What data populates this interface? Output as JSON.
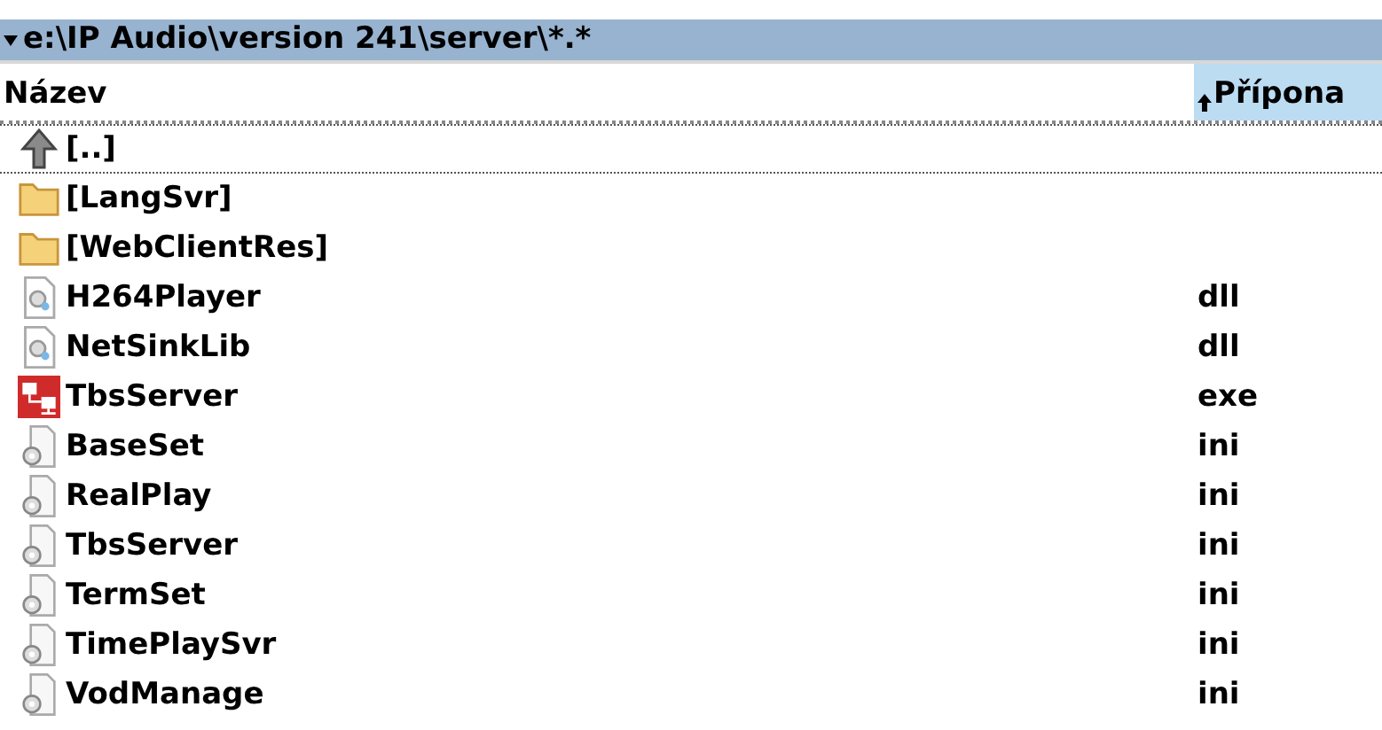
{
  "path_bar": {
    "path": "e:\\IP Audio\\version 241\\server\\*.*"
  },
  "columns": [
    {
      "label": "Název",
      "sorted": false
    },
    {
      "label": "Přípona",
      "sorted": true
    }
  ],
  "files": [
    {
      "kind": "parent",
      "name": "[..]",
      "focused": true
    },
    {
      "kind": "folder",
      "name": "[LangSvr]",
      "focused": false
    },
    {
      "kind": "folder",
      "name": "[WebClientRes]",
      "focused": false
    },
    {
      "kind": "dll",
      "name": "H264Player",
      "ext": "dll",
      "focused": false
    },
    {
      "kind": "dll",
      "name": "NetSinkLib",
      "ext": "dll",
      "focused": false
    },
    {
      "kind": "exe",
      "name": "TbsServer",
      "ext": "exe",
      "focused": false
    },
    {
      "kind": "ini",
      "name": "BaseSet",
      "ext": "ini",
      "focused": false
    },
    {
      "kind": "ini",
      "name": "RealPlay",
      "ext": "ini",
      "focused": false
    },
    {
      "kind": "ini",
      "name": "TbsServer",
      "ext": "ini",
      "focused": false
    },
    {
      "kind": "ini",
      "name": "TermSet",
      "ext": "ini",
      "focused": false
    },
    {
      "kind": "ini",
      "name": "TimePlaySvr",
      "ext": "ini",
      "focused": false
    },
    {
      "kind": "ini",
      "name": "VodManage",
      "ext": "ini",
      "focused": false
    }
  ]
}
